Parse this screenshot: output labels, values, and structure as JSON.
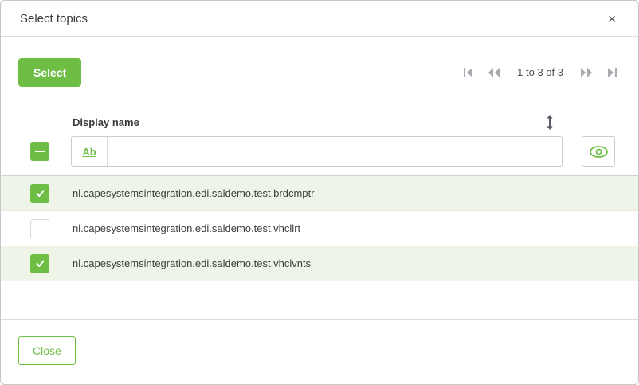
{
  "modal": {
    "title": "Select topics"
  },
  "header": {
    "close_icon": "×"
  },
  "toolbar": {
    "select_label": "Select"
  },
  "pagination": {
    "status": "1 to 3 of 3",
    "first_icon": "first-page",
    "previous_icon": "previous-page",
    "next_icon": "next-page",
    "last_icon": "last-page"
  },
  "table": {
    "column_header": "Display name",
    "sort_icon": "vertical-double-arrow",
    "filter": {
      "type_label": "Ab",
      "value": "",
      "eye_icon": "eye"
    },
    "rows": [
      {
        "name": "nl.capesystemsintegration.edi.saldemo.test.brdcmptr",
        "checked": true
      },
      {
        "name": "nl.capesystemsintegration.edi.saldemo.test.vhcllrt",
        "checked": false
      },
      {
        "name": "nl.capesystemsintegration.edi.saldemo.test.vhclvnts",
        "checked": true
      }
    ]
  },
  "footer": {
    "close_label": "Close"
  },
  "colors": {
    "primary_green": "#6ebe45",
    "selected_row_bg": "#eef5e8",
    "border_gray": "#cccccc",
    "text": "#3d3d3d",
    "pagination_icon": "#a4aab0"
  }
}
